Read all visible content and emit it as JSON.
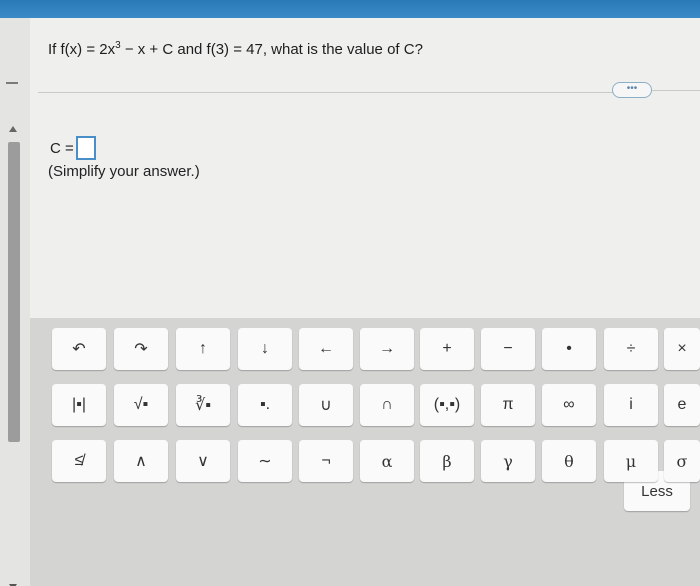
{
  "question": {
    "prefix": "If f(x) = 2x",
    "exponent": "3",
    "suffix": " − x + C and f(3) = 47, what is the value of C?"
  },
  "answer": {
    "label": "C =",
    "value": ""
  },
  "hint": "(Simplify your answer.)",
  "more_label": "•••",
  "keypad": {
    "rows": [
      [
        "↶",
        "↷",
        "↑",
        "↓",
        "←",
        "→",
        "+",
        "−",
        "•",
        "÷",
        "×"
      ],
      [
        "|▪|",
        "√▪",
        "∛▪",
        "▪.",
        "∪",
        "∩",
        "(▪,▪)",
        "π",
        "∞",
        "i",
        "e"
      ],
      [
        "≰",
        "∧",
        "∨",
        "∼",
        "¬",
        "α",
        "β",
        "γ",
        "θ",
        "μ",
        "σ"
      ]
    ],
    "less_label": "Less"
  }
}
